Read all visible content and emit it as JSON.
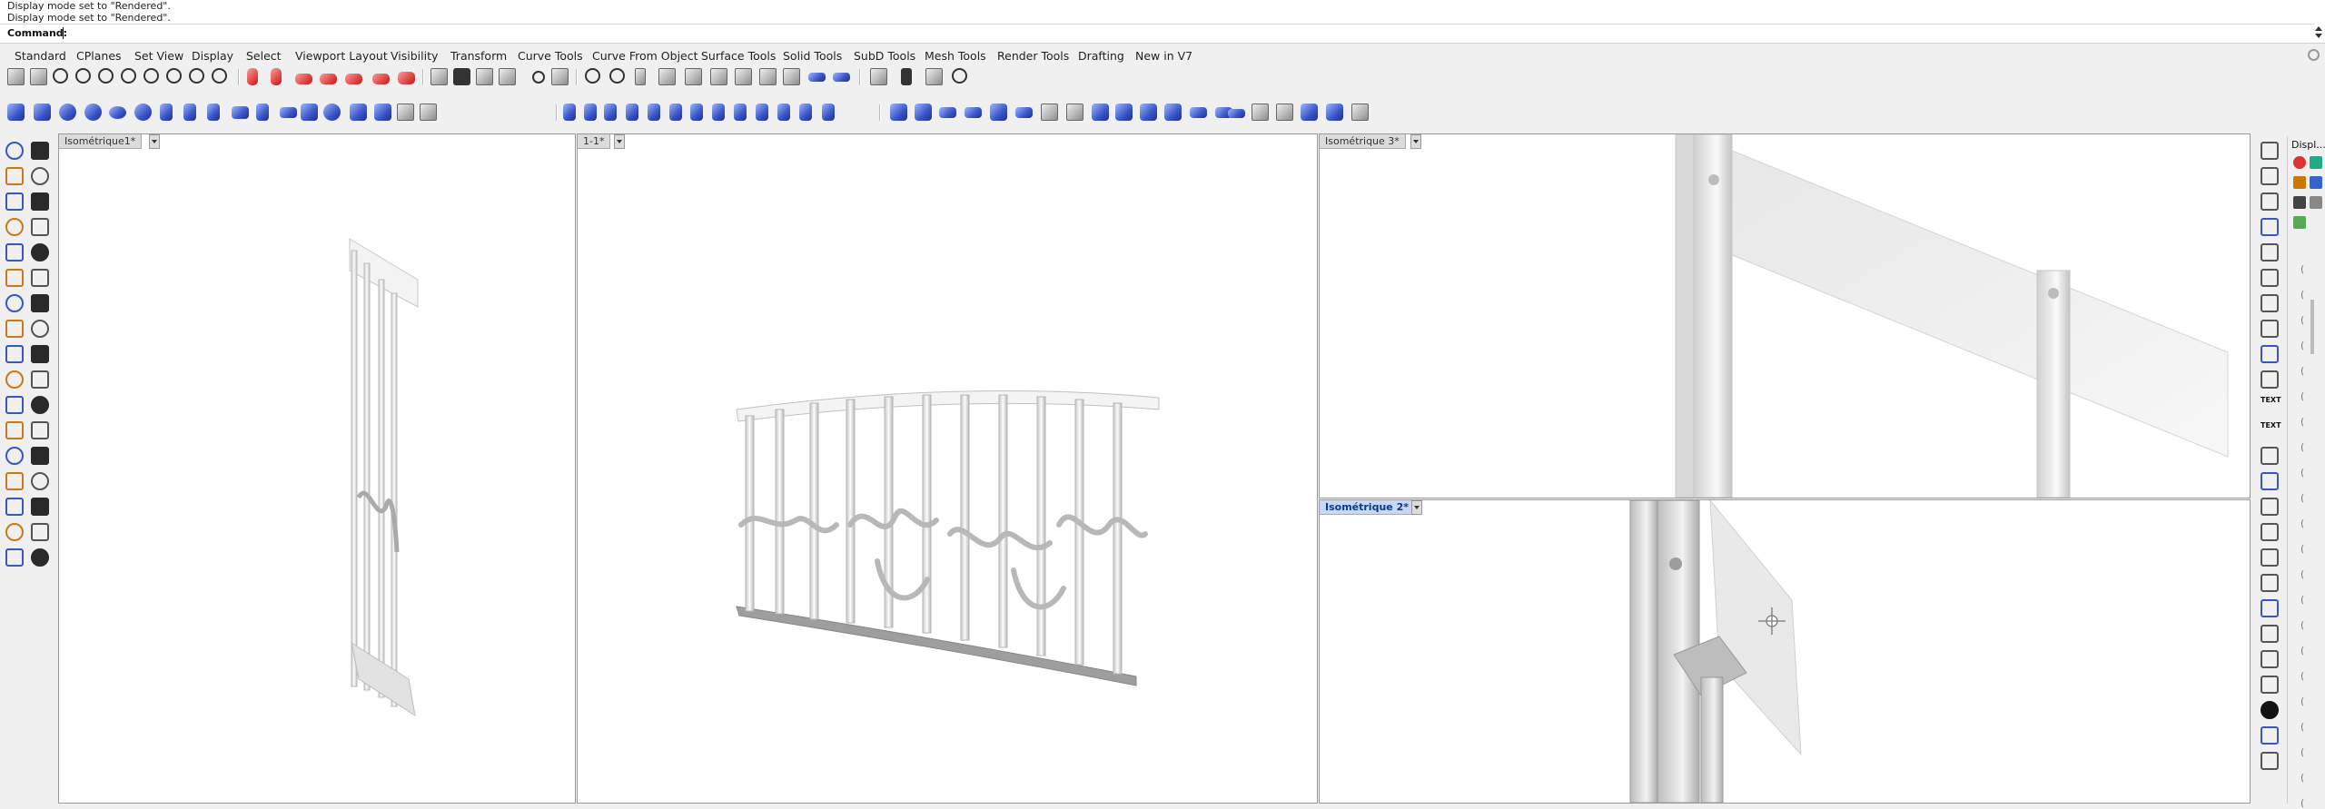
{
  "command_history": [
    "Display mode set to \"Rendered\".",
    "Display mode set to \"Rendered\"."
  ],
  "command_prompt": "Command:",
  "toolbar_tabs": [
    "Standard",
    "CPlanes",
    "Set View",
    "Display",
    "Select",
    "Viewport Layout",
    "Visibility",
    "Transform",
    "Curve Tools",
    "Curve From Object",
    "Surface Tools",
    "Solid Tools",
    "SubD Tools",
    "Mesh Tools",
    "Render Tools",
    "Drafting",
    "New in V7"
  ],
  "active_tab": "Standard",
  "viewports": {
    "left": {
      "title": "Isométrique1*"
    },
    "center": {
      "title": "1-1*"
    },
    "top_right": {
      "title": "Isométrique 3*"
    },
    "bottom_right": {
      "title": "Isométrique 2*",
      "active": true
    }
  },
  "right_panel": {
    "title": "Displ...",
    "text_icons": [
      "TEXT",
      "TEXT"
    ]
  },
  "colors": {
    "accent": "#c6d8f5",
    "active_tab_text": "#0a3a8a",
    "viewport_bg": "#ffffff",
    "chrome_bg": "#f0f0f0"
  }
}
